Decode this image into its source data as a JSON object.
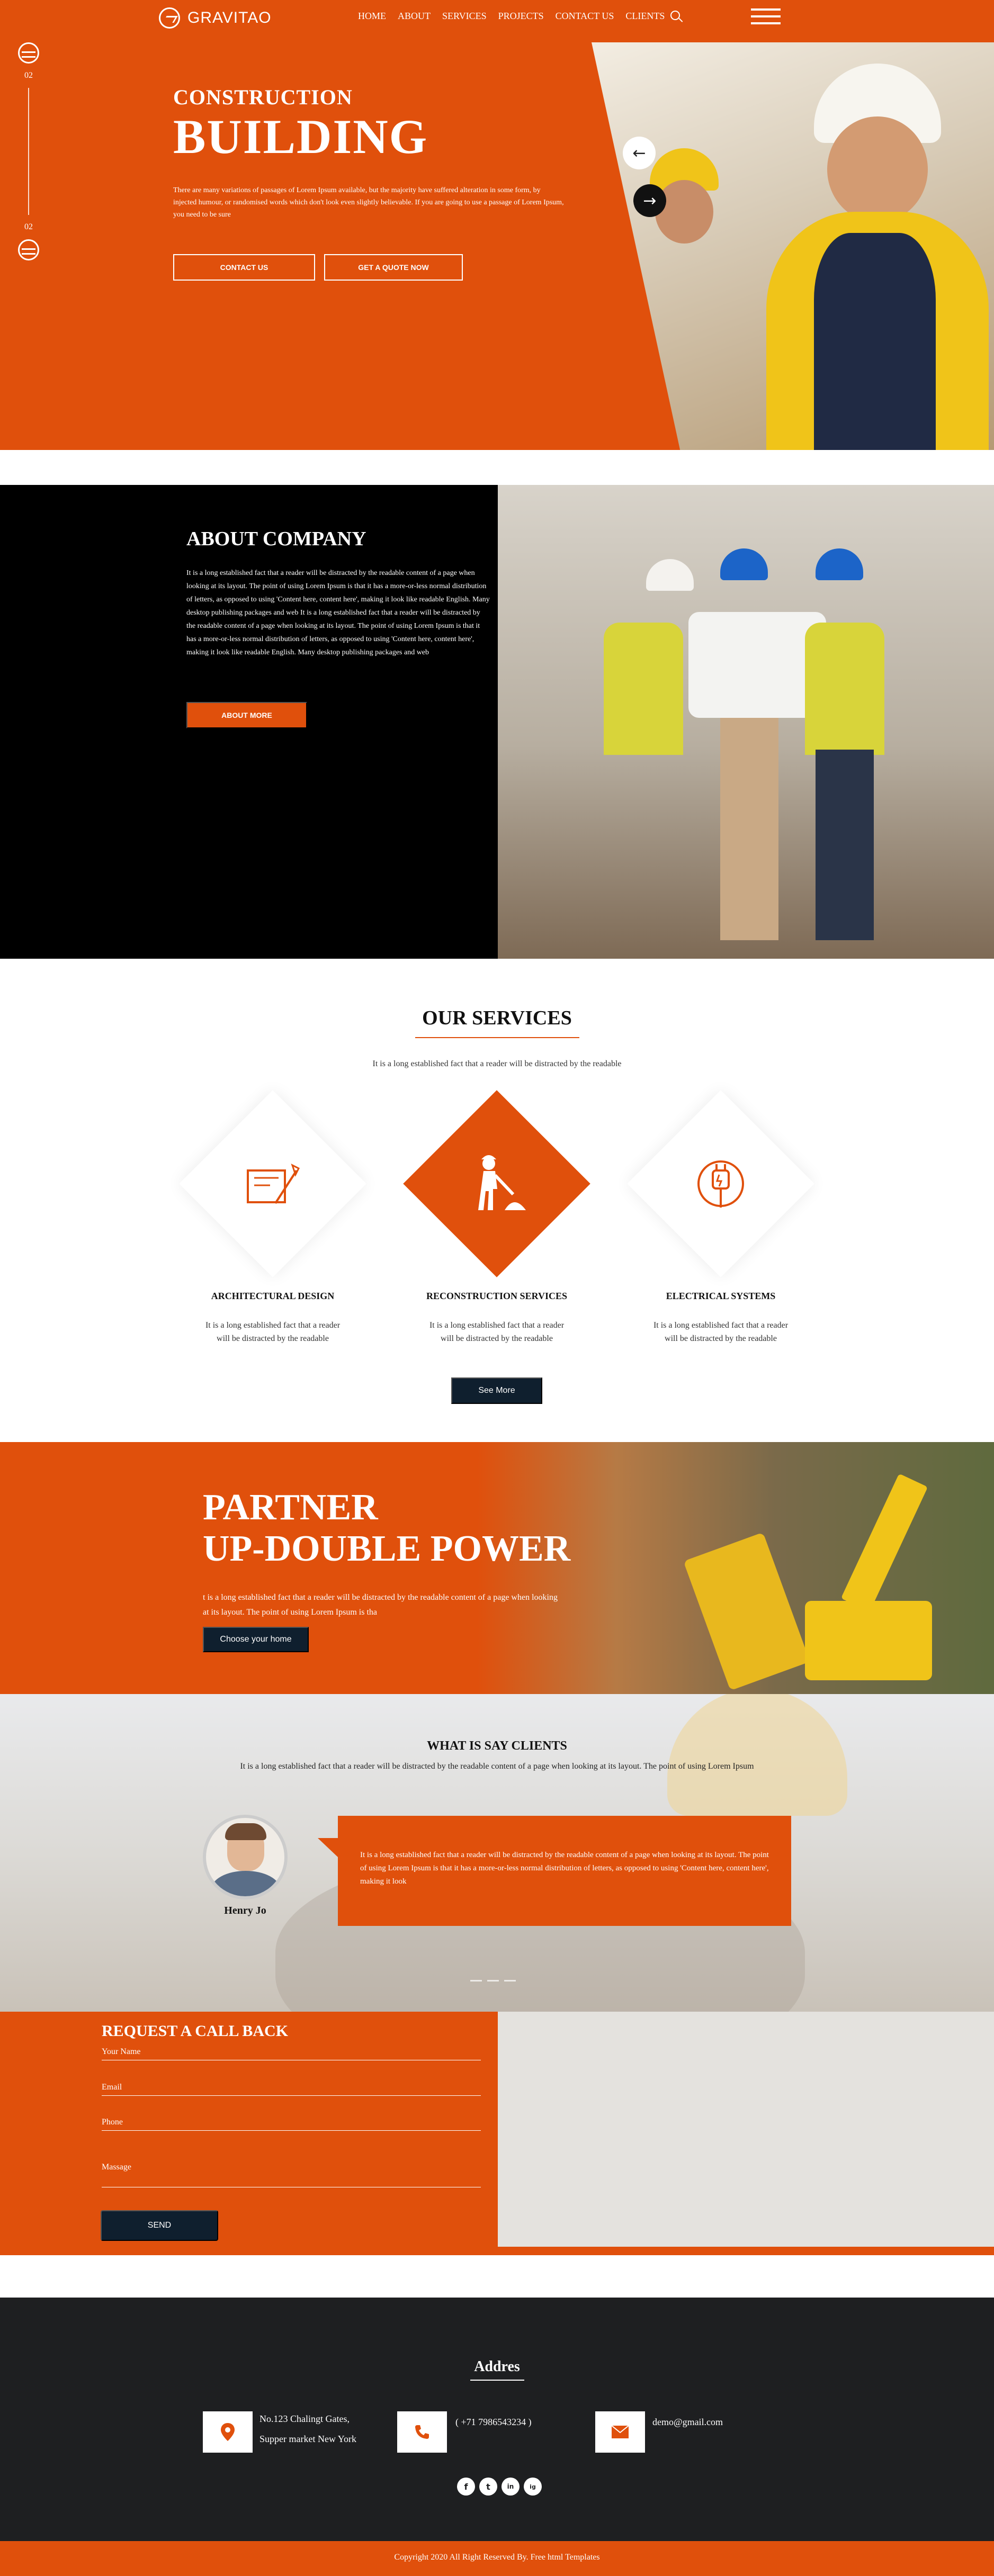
{
  "brand": {
    "name": "GRAVITAO",
    "accent": "#e0500c",
    "dark": "#0f1f2e"
  },
  "nav": {
    "items": [
      "HOME",
      "ABOUT",
      "SERVICES",
      "PROJECTS",
      "CONTACT US",
      "CLIENTS"
    ],
    "search_icon": "search-icon",
    "menu_icon": "hamburger-icon"
  },
  "hero": {
    "slide_top": "02",
    "slide_bottom": "02",
    "kicker": "CONSTRUCTION",
    "title": "BUILDING",
    "text": "There are many variations of passages of Lorem Ipsum available, but the majority have suffered alteration in some form, by injected humour, or randomised words which don't look even slightly believable. If you are going to use a passage of Lorem Ipsum, you need to be sure",
    "btn_contact": "CONTACT US",
    "btn_quote": "GET A QUOTE NOW",
    "prev_icon": "arrow-left-icon",
    "next_icon": "arrow-right-icon"
  },
  "about": {
    "title": "ABOUT COMPANY",
    "text": "It is a long established fact that a reader will be distracted by the readable content of a page when looking at its layout. The point of using Lorem Ipsum is that it has a more-or-less normal distribution of letters, as opposed to using 'Content here, content here', making it look like readable English. Many desktop publishing packages and web It is a long established fact that a reader will be distracted by the readable content of a page when looking at its layout. The point of using Lorem Ipsum is that it has a more-or-less normal distribution of letters, as opposed to using 'Content here, content here', making it look like readable English. Many desktop publishing packages and web",
    "button": "ABOUT MORE"
  },
  "services": {
    "title": "OUR SERVICES",
    "subtitle": "It is a long established fact that a reader will be distracted by the readable",
    "items": [
      {
        "name": "ARCHITECTURAL DESIGN",
        "text": "It is a long established fact that a reader will be distracted by the readable",
        "icon": "blueprint-icon"
      },
      {
        "name": "RECONSTRUCTION SERVICES",
        "text": "It is a long established fact that a reader will be distracted by the readable",
        "icon": "worker-digging-icon"
      },
      {
        "name": "ELECTRICAL SYSTEMS",
        "text": "It is a long established fact that a reader will be distracted by the readable",
        "icon": "plug-icon"
      }
    ],
    "button": "See More"
  },
  "partner": {
    "title_line1": "PARTNER",
    "title_line2": "UP-DOUBLE POWER",
    "text": "t is a long established fact that a reader will be distracted by the readable content of a page when looking at its layout. The point of using Lorem Ipsum is tha",
    "button": "Choose your home"
  },
  "clients": {
    "title": "WHAT IS SAY CLIENTS",
    "subtitle": "It is a long established fact that a reader will be distracted by the readable content of a page when looking at its layout. The point of using Lorem Ipsum",
    "name": "Henry Jo",
    "quote": "It is a long established fact that a reader will be distracted by the readable content of a page when looking at its layout. The point of using Lorem Ipsum is that it has a more-or-less normal distribution of letters, as opposed to using 'Content here, content here', making it look"
  },
  "request": {
    "title": "REQUEST A CALL BACK",
    "fields": {
      "name": "Your Name",
      "email": "Email",
      "phone": "Phone",
      "message": "Massage"
    },
    "button": "SEND"
  },
  "footer": {
    "title": "Addres",
    "address_line1": "No.123 Chalingt Gates,",
    "address_line2": "Supper market New York",
    "phone": "( +71 7986543234 )",
    "email": "demo@gmail.com",
    "socials": [
      "f",
      "t",
      "in",
      "ig"
    ],
    "copyright": "Copyright 2020 All Right Reserved By. Free html Templates"
  }
}
